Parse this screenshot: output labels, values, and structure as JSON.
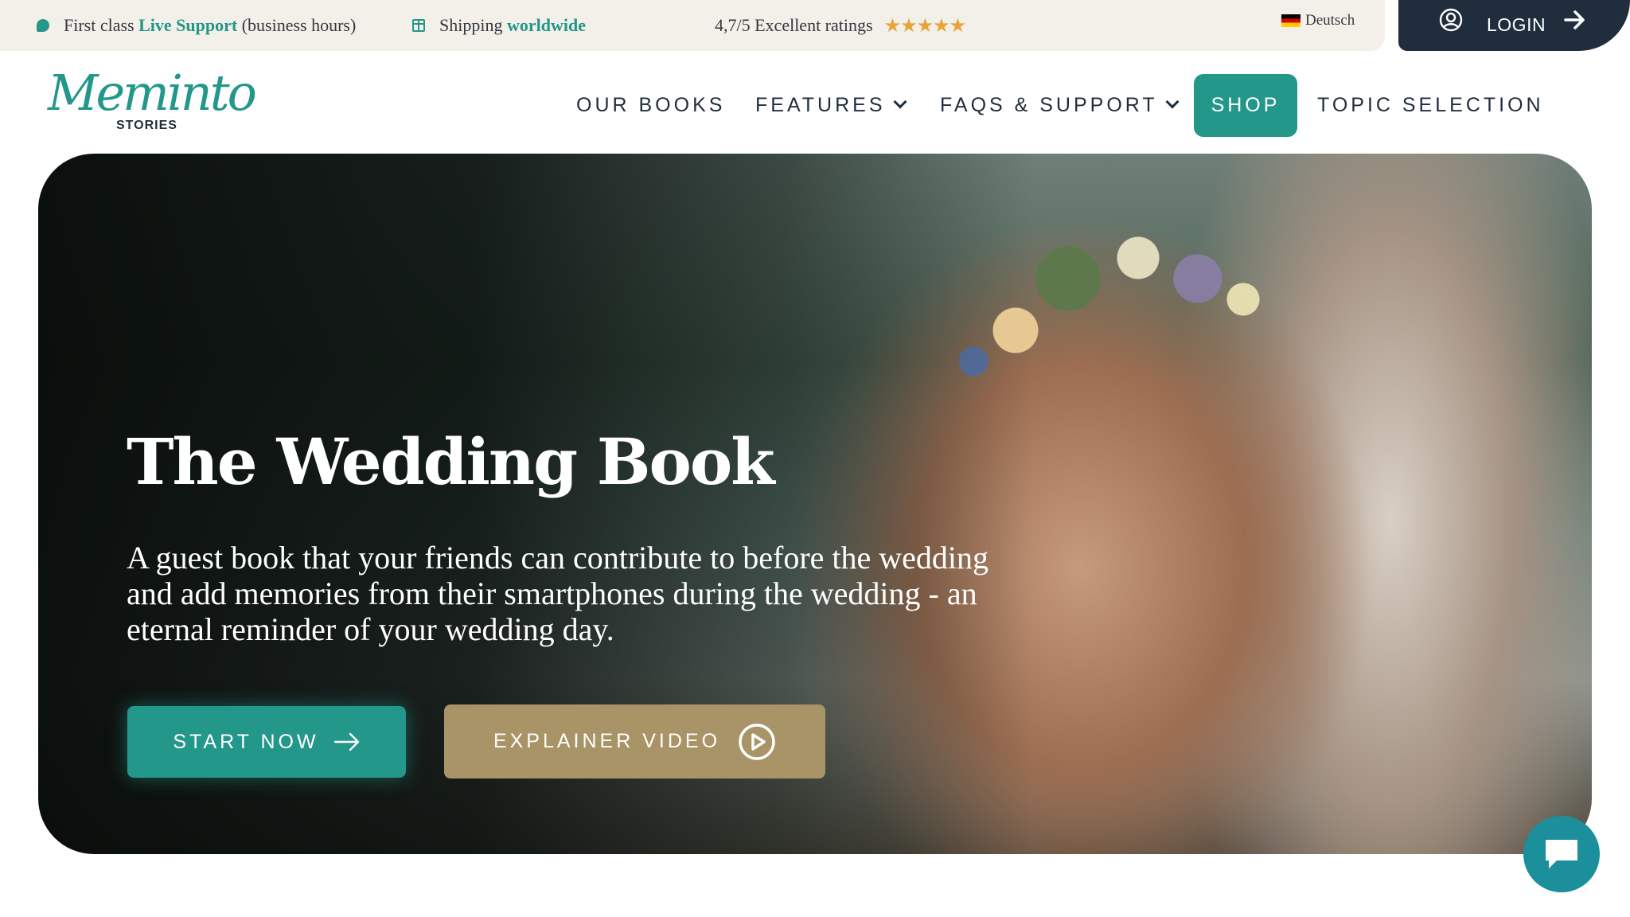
{
  "topbar": {
    "support_prefix": "First class ",
    "support_accent": "Live Support",
    "support_suffix": " (business hours)",
    "shipping_prefix": "Shipping ",
    "shipping_accent": "worldwide",
    "rating_text": "4,7/5 Excellent ratings",
    "stars": "★★★★★",
    "language": "Deutsch",
    "login_label": "LOGIN"
  },
  "logo": {
    "script": "Meminto",
    "sub": "STORIES"
  },
  "nav": {
    "our_books": "OUR BOOKS",
    "features": "FEATURES",
    "faqs": "FAQS & SUPPORT",
    "shop": "SHOP",
    "topic_selection": "TOPIC SELECTION"
  },
  "hero": {
    "title": "The Wedding Book",
    "description": "A guest book that your friends can contribute to before the wedding and add memories from their smartphones during the wedding - an eternal reminder of your wedding day.",
    "start_label": "START NOW",
    "video_label": "EXPLAINER VIDEO"
  },
  "colors": {
    "accent": "#23978a",
    "dark": "#1f2d3d",
    "gold": "#a89466",
    "chat": "#1b8f9c"
  },
  "icons": {
    "support": "chat-bubble-icon",
    "shipping": "gift-icon",
    "rating": "star-icon",
    "language": "german-flag-icon",
    "login_user": "user-circle-icon",
    "login_arrow": "arrow-right-icon",
    "dropdown": "chevron-down-icon",
    "start": "arrow-right-icon",
    "video": "play-circle-icon",
    "chat": "chat-icon"
  }
}
